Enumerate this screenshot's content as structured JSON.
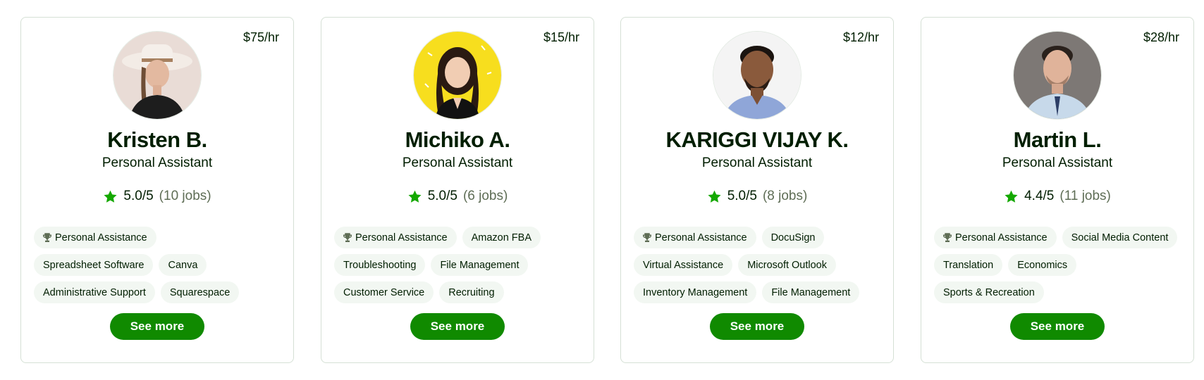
{
  "accent_color": "#108a00",
  "star_color": "#14a800",
  "freelancers": [
    {
      "rate": "$75/hr",
      "name": "Kristen B.",
      "title": "Personal Assistant",
      "score": "5.0/5",
      "jobs": "(10 jobs)",
      "skills": [
        "Personal Assistance",
        "Spreadsheet Software",
        "Canva",
        "Administrative Support",
        "Squarespace"
      ],
      "button": "See more"
    },
    {
      "rate": "$15/hr",
      "name": "Michiko A.",
      "title": "Personal Assistant",
      "score": "5.0/5",
      "jobs": "(6 jobs)",
      "skills": [
        "Personal Assistance",
        "Amazon FBA",
        "Troubleshooting",
        "File Management",
        "Customer Service",
        "Recruiting"
      ],
      "button": "See more"
    },
    {
      "rate": "$12/hr",
      "name": "KARIGGI VIJAY K.",
      "title": "Personal Assistant",
      "score": "5.0/5",
      "jobs": "(8 jobs)",
      "skills": [
        "Personal Assistance",
        "DocuSign",
        "Virtual Assistance",
        "Microsoft Outlook",
        "Inventory Management",
        "File Management"
      ],
      "button": "See more"
    },
    {
      "rate": "$28/hr",
      "name": "Martin L.",
      "title": "Personal Assistant",
      "score": "4.4/5",
      "jobs": "(11 jobs)",
      "skills": [
        "Personal Assistance",
        "Social Media Content",
        "Translation",
        "Economics",
        "Sports & Recreation"
      ],
      "button": "See more"
    }
  ],
  "icons": {
    "rating": "star-icon",
    "top_skill": "trophy-icon"
  }
}
